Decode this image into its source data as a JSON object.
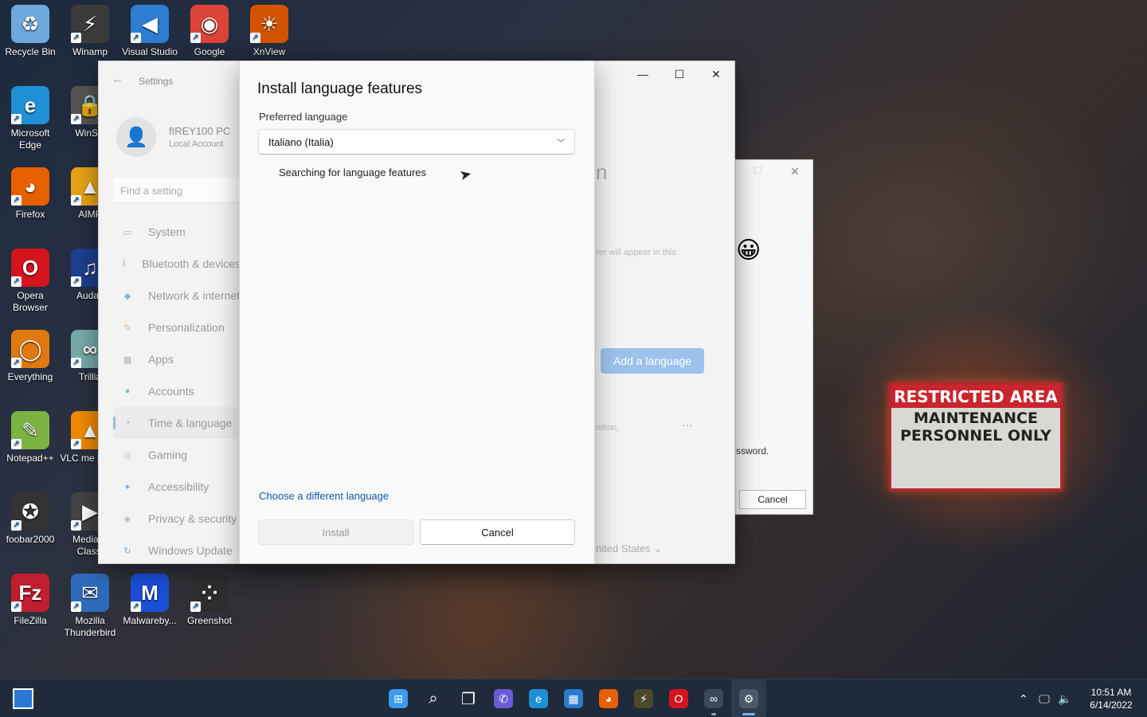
{
  "desktop": {
    "icons": [
      {
        "label": "Recycle Bin",
        "glyph": "♻",
        "color": "#6fa8dc"
      },
      {
        "label": "Winamp",
        "glyph": "⚡",
        "color": "#3b3b3b"
      },
      {
        "label": "Visual Studio",
        "glyph": "◀",
        "color": "#2d7dd2"
      },
      {
        "label": "Google",
        "glyph": "◉",
        "color": "#db4437"
      },
      {
        "label": "XnView",
        "glyph": "☀",
        "color": "#d35400"
      },
      {
        "label": "Microsoft Edge",
        "glyph": "e",
        "color": "#1f8fd6"
      },
      {
        "label": "WinSC",
        "glyph": "🔒",
        "color": "#555"
      },
      {
        "label": "Firefox",
        "glyph": "◕",
        "color": "#e66000"
      },
      {
        "label": "AIMP",
        "glyph": "▲",
        "color": "#e8a317"
      },
      {
        "label": "Opera Browser",
        "glyph": "O",
        "color": "#d4141c"
      },
      {
        "label": "Audac",
        "glyph": "♫",
        "color": "#1d3f8f"
      },
      {
        "label": "Everything",
        "glyph": "◯",
        "color": "#e07a10"
      },
      {
        "label": "Trillia",
        "glyph": "∞",
        "color": "#7aa"
      },
      {
        "label": "Notepad++",
        "glyph": "✎",
        "color": "#7cb342"
      },
      {
        "label": "VLC me playe",
        "glyph": "▲",
        "color": "#f08a00"
      },
      {
        "label": "foobar2000",
        "glyph": "✪",
        "color": "#333"
      },
      {
        "label": "Media P Classi",
        "glyph": "▶",
        "color": "#444"
      },
      {
        "label": "FileZilla",
        "glyph": "Fz",
        "color": "#bf1e2e"
      },
      {
        "label": "Mozilla Thunderbird",
        "glyph": "✉",
        "color": "#2f6bbd"
      },
      {
        "label": "Malwareby...",
        "glyph": "M",
        "color": "#1b4fd8"
      },
      {
        "label": "Greenshot",
        "glyph": "⁘",
        "color": "#2e2e2e"
      }
    ],
    "sign": {
      "top": "RESTRICTED AREA",
      "bottom": "MAINTENANCE PERSONNEL ONLY"
    }
  },
  "settings_window": {
    "title": "Settings",
    "account_name": "fIREY100 PC",
    "account_type": "Local Account",
    "search_placeholder": "Find a setting",
    "nav": [
      {
        "label": "System",
        "color": "#4a90d9",
        "glyph": "▭"
      },
      {
        "label": "Bluetooth & devices",
        "color": "#1e7bd6",
        "glyph": "ᛒ"
      },
      {
        "label": "Network & internet",
        "color": "#3a86d4",
        "glyph": "◆"
      },
      {
        "label": "Personalization",
        "color": "#c58a3a",
        "glyph": "✎"
      },
      {
        "label": "Apps",
        "color": "#7a8aa0",
        "glyph": "▦"
      },
      {
        "label": "Accounts",
        "color": "#2fa86b",
        "glyph": "●"
      },
      {
        "label": "Time & language",
        "color": "#2a8fd8",
        "glyph": "◔"
      },
      {
        "label": "Gaming",
        "color": "#8a8a8a",
        "glyph": "◎"
      },
      {
        "label": "Accessibility",
        "color": "#2a78c8",
        "glyph": "✦"
      },
      {
        "label": "Privacy & security",
        "color": "#8a8a8a",
        "glyph": "◈"
      },
      {
        "label": "Windows Update",
        "color": "#1e7bd6",
        "glyph": "↻"
      }
    ],
    "behind": {
      "heading_fragment": "n",
      "hint_top": "rer will appear in this",
      "add_language": "Add a language",
      "hint_mid": "nition,",
      "more": "···",
      "region": "nited States"
    }
  },
  "mini_window": {
    "text": "ssword.",
    "cancel": "Cancel"
  },
  "dialog": {
    "title": "Install language features",
    "preferred_label": "Preferred language",
    "selected_language": "Italiano (Italia)",
    "status": "Searching for language features",
    "different_link": "Choose a different language",
    "install": "Install",
    "cancel": "Cancel"
  },
  "taskbar": {
    "apps": [
      {
        "name": "start",
        "glyph": "⊞",
        "color": "#3a9bf0"
      },
      {
        "name": "search",
        "glyph": "⌕",
        "color": "transparent"
      },
      {
        "name": "task-view",
        "glyph": "❐",
        "color": "transparent"
      },
      {
        "name": "chat",
        "glyph": "✆",
        "color": "#6b5bd6"
      },
      {
        "name": "edge",
        "glyph": "e",
        "color": "#1f8fd6"
      },
      {
        "name": "store",
        "glyph": "▦",
        "color": "#2a7ad2"
      },
      {
        "name": "firefox",
        "glyph": "◕",
        "color": "#e66000"
      },
      {
        "name": "winamp",
        "glyph": "⚡",
        "color": "#4a4a2a"
      },
      {
        "name": "opera",
        "glyph": "O",
        "color": "#d4141c"
      },
      {
        "name": "trillian",
        "glyph": "∞",
        "color": "#3a4a5a"
      },
      {
        "name": "settings",
        "glyph": "⚙",
        "color": "#4a5a6a"
      }
    ],
    "time": "10:51 AM",
    "date": "6/14/2022"
  }
}
